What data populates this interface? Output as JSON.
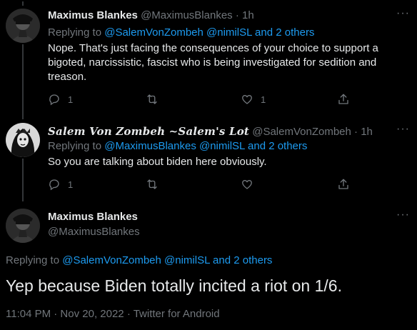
{
  "tweets": [
    {
      "display_name": "Maximus Blankes",
      "handle": "@MaximusBlankes",
      "sep": "·",
      "time": "1h",
      "replying_prefix": "Replying to",
      "replying_to": "@SalemVonZombeh @nimilSL and 2 others",
      "text": "Nope.  That's just facing the consequences of your choice to support a bigoted, narcissistic, fascist who is being investigated for sedition and treason.",
      "reply_count": "1",
      "like_count": "1",
      "more": "···"
    },
    {
      "display_name": "Salem Von Zombeh ~Salem's Lot",
      "handle": "@SalemVonZombeh",
      "sep": "·",
      "time": "1h",
      "replying_prefix": "Replying to",
      "replying_to": "@MaximusBlankes @nimilSL and 2 others",
      "text": "So you are talking about biden here obviously.",
      "reply_count": "1",
      "more": "···"
    }
  ],
  "main_tweet": {
    "display_name": "Maximus Blankes",
    "handle": "@MaximusBlankes",
    "replying_prefix": "Replying to",
    "replying_to": "@SalemVonZombeh @nimilSL and 2 others",
    "text": "Yep because Biden totally incited a riot on 1/6.",
    "timestamp": "11:04 PM · Nov 20, 2022 · Twitter for Android",
    "more": "···"
  },
  "colors": {
    "background": "#000000",
    "text": "#e7e9ea",
    "muted": "#71767b",
    "link": "#1d9bf0",
    "thread_line": "#333639"
  },
  "icons": [
    "reply-icon",
    "retweet-icon",
    "like-icon",
    "share-icon",
    "more-icon"
  ]
}
